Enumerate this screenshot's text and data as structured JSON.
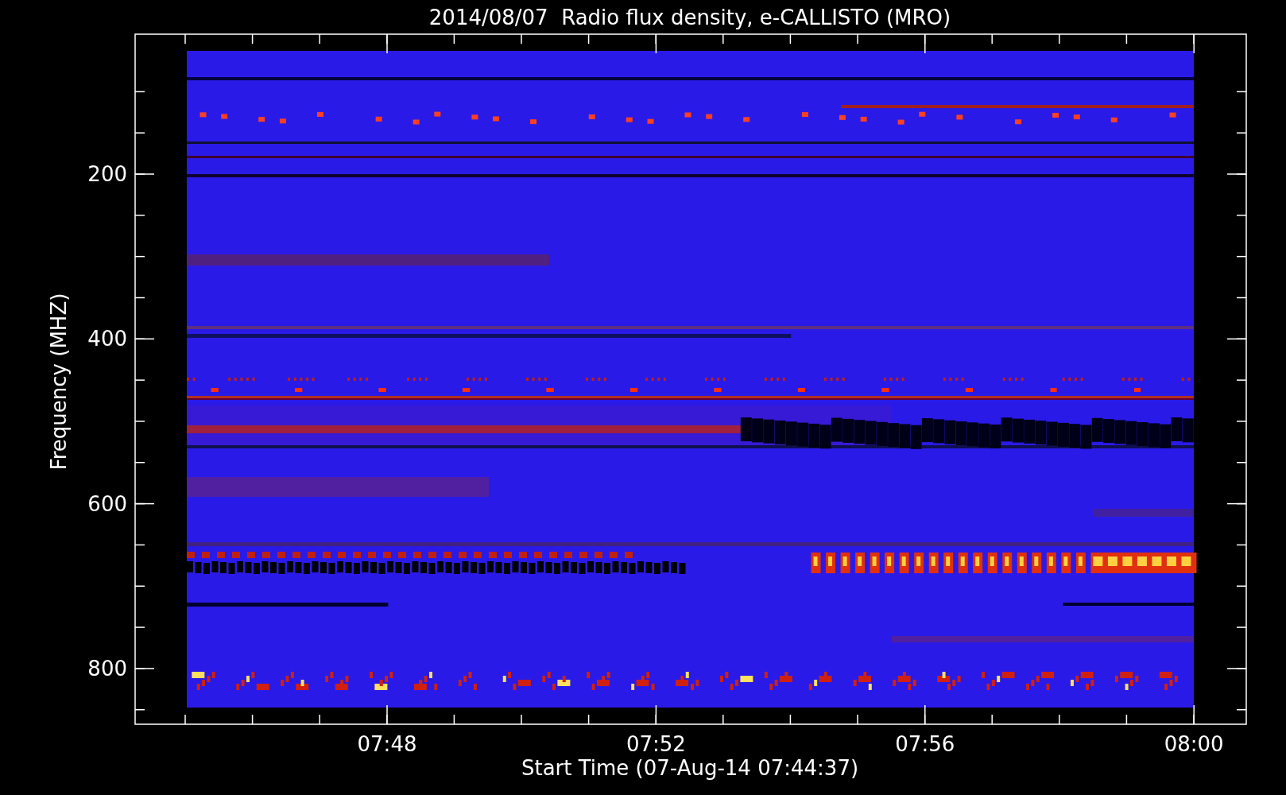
{
  "title": "2014/08/07  Radio flux density, e-CALLISTO (MRO)",
  "y_axis": {
    "label": "Frequency (MHZ)",
    "ticks": [
      "200",
      "400",
      "600",
      "800"
    ]
  },
  "x_axis": {
    "label": "Start Time (07-Aug-14 07:44:37)",
    "ticks": [
      "07:48",
      "07:52",
      "07:56",
      "08:00"
    ]
  }
}
